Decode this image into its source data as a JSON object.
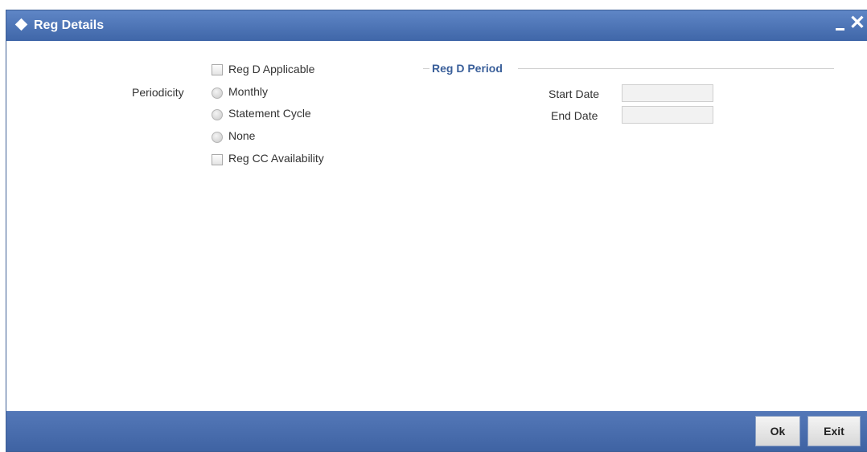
{
  "window": {
    "title": "Reg Details",
    "minimize_label": "–",
    "close_label": "✕"
  },
  "form": {
    "reg_d_applicable": {
      "label": "Reg D Applicable",
      "checked": false
    },
    "periodicity": {
      "label": "Periodicity",
      "options": [
        "Monthly",
        "Statement Cycle",
        "None"
      ],
      "selected": null
    },
    "reg_cc_availability": {
      "label": "Reg CC Availability",
      "checked": false
    }
  },
  "reg_d_period": {
    "legend": "Reg D Period",
    "start_date_label": "Start Date",
    "start_date_value": "",
    "end_date_label": "End Date",
    "end_date_value": ""
  },
  "footer": {
    "ok_label": "Ok",
    "exit_label": "Exit"
  },
  "colors": {
    "titlebar": "#4a72b4",
    "footer": "#4a6eae",
    "legend": "#3a5f9a"
  }
}
